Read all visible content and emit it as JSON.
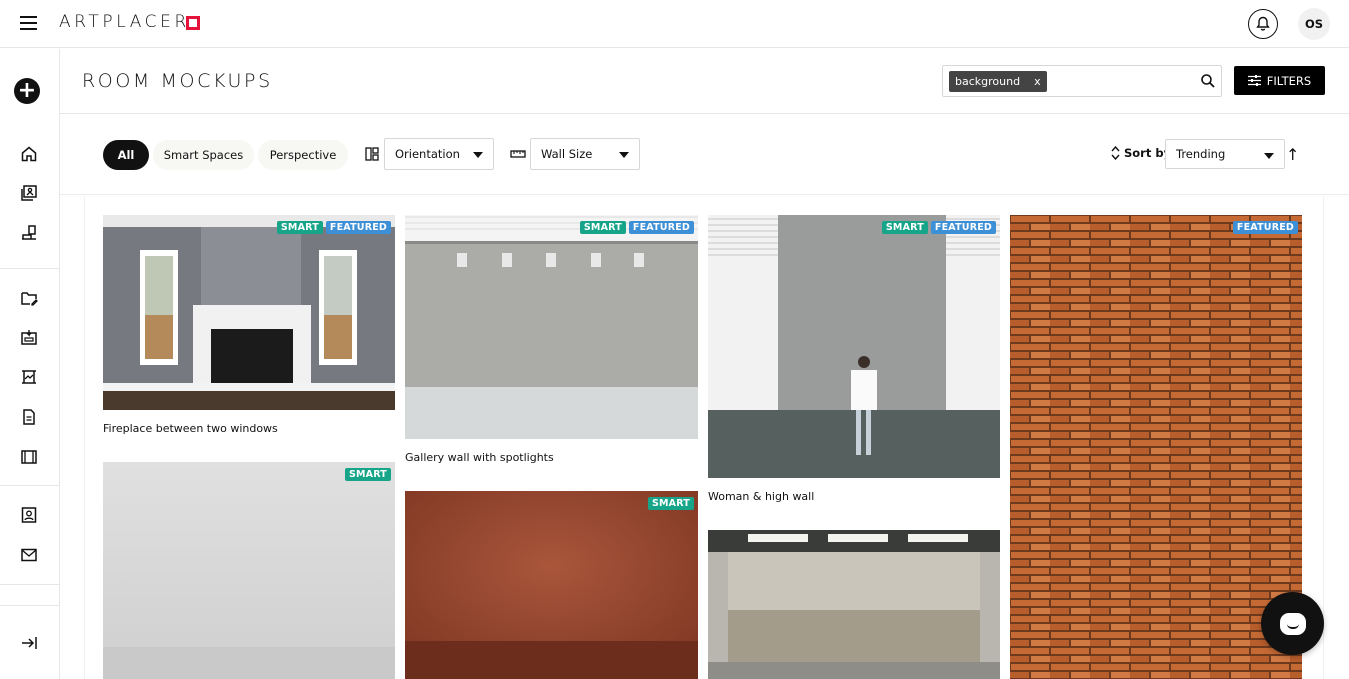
{
  "app": {
    "logo_text": "ARTPLACER",
    "avatar_initials": "OS"
  },
  "page": {
    "title": "ROOM MOCKUPS"
  },
  "search": {
    "chip_label": "background",
    "chip_remove": "x",
    "placeholder": "",
    "value": ""
  },
  "filters_button": {
    "label": "FILTERS"
  },
  "tabs": [
    {
      "label": "All",
      "active": true
    },
    {
      "label": "Smart Spaces",
      "active": false
    },
    {
      "label": "Perspective",
      "active": false
    }
  ],
  "orientation_dropdown": {
    "label": "Orientation"
  },
  "wall_size_dropdown": {
    "label": "Wall Size"
  },
  "sort": {
    "label": "Sort by",
    "value": "Trending",
    "direction_icon": "arrow-up-icon"
  },
  "sidebar": {
    "icons": [
      "add-icon",
      "home-icon",
      "collections-icon",
      "room-mockups-icon",
      "folder-edit-icon",
      "upload-room-icon",
      "gallery-wall-icon",
      "document-icon",
      "frame-icon",
      "contact-card-icon",
      "mail-icon",
      "collapse-sidebar-icon"
    ]
  },
  "cards": [
    {
      "caption": "Fireplace between two windows",
      "badges": [
        "SMART",
        "FEATURED"
      ]
    },
    {
      "caption": "",
      "badges": [
        "SMART"
      ]
    },
    {
      "caption": "Gallery wall with spotlights",
      "badges": [
        "SMART",
        "FEATURED"
      ]
    },
    {
      "caption": "",
      "badges": [
        "SMART"
      ]
    },
    {
      "caption": "Woman & high wall",
      "badges": [
        "SMART",
        "FEATURED"
      ]
    },
    {
      "caption": "",
      "badges": []
    },
    {
      "caption": "",
      "badges": [
        "FEATURED"
      ]
    }
  ],
  "colors": {
    "smart_badge": "#17a589",
    "featured_badge": "#3d8fd6",
    "logo_accent": "#e5133a"
  }
}
